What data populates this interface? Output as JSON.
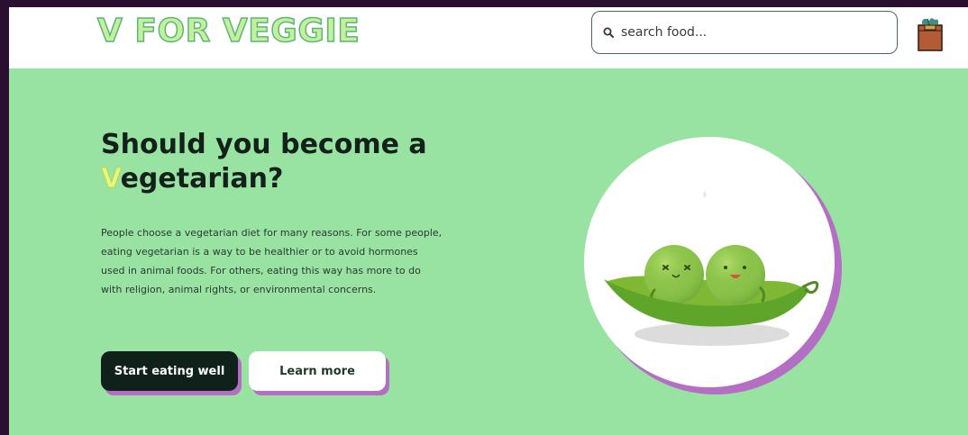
{
  "header": {
    "logo": "V FOR VEGGIE",
    "search": {
      "placeholder": "search food..."
    },
    "cart_icon": "shopping-bag-icon"
  },
  "hero": {
    "title_first_letter": "V",
    "title_line1": "Should you become a",
    "title_line2_rest": "egetarian?",
    "description": "People choose a vegetarian diet for many reasons. For some people, eating vegetarian is a way to be healthier or to avoid hormones used in animal foods. For others, eating this way has more to do with religion, animal rights, or environmental concerns.",
    "primary_button": "Start eating well",
    "secondary_button": "Learn more",
    "illustration": "peas-in-pod-illustration"
  },
  "colors": {
    "background": "#98e3a2",
    "accent_shadow": "#b46fc4",
    "primary_button": "#10201a",
    "logo": "#c3ef9e"
  }
}
